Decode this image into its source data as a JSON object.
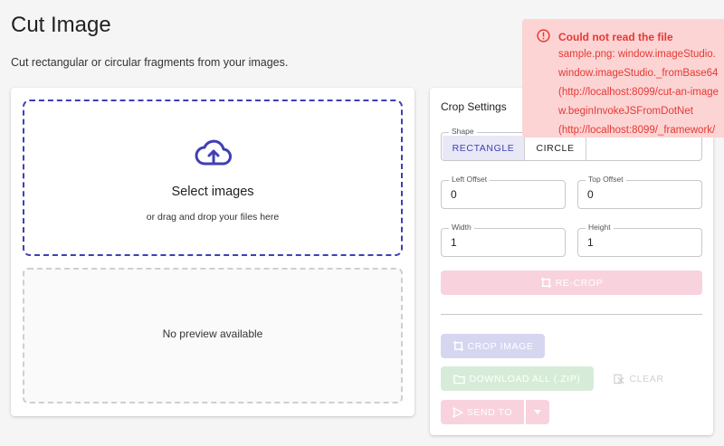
{
  "page": {
    "title": "Cut Image",
    "subtitle": "Cut rectangular or circular fragments from your images."
  },
  "upload": {
    "title": "Select images",
    "hint": "or drag and drop your files here",
    "icon": "cloud-upload-icon"
  },
  "preview": {
    "message": "No preview available"
  },
  "settings": {
    "title": "Crop Settings",
    "shape_label": "Shape",
    "shapes": [
      "RECTANGLE",
      "CIRCLE"
    ],
    "selected_shape": "RECTANGLE",
    "left_offset": {
      "label": "Left Offset",
      "value": "0"
    },
    "top_offset": {
      "label": "Top Offset",
      "value": "0"
    },
    "width": {
      "label": "Width",
      "value": "1"
    },
    "height": {
      "label": "Height",
      "value": "1"
    },
    "recrop_label": "RE-CROP",
    "crop_label": "CROP IMAGE",
    "download_label": "DOWNLOAD ALL (.ZIP)",
    "clear_label": "CLEAR",
    "send_label": "SEND TO"
  },
  "error": {
    "title": "Could not read the file",
    "lines": [
      "sample.png: window.imageStudio.",
      "window.imageStudio._fromBase64",
      "(http://localhost:8099/cut-an-image",
      "w.beginInvokeJSFromDotNet",
      "(http://localhost:8099/_framework/"
    ]
  },
  "colors": {
    "primary": "#3f3fb5",
    "error": "#e53935",
    "error_bg": "#fcd4d4",
    "page_bg": "#f5f5f5"
  }
}
